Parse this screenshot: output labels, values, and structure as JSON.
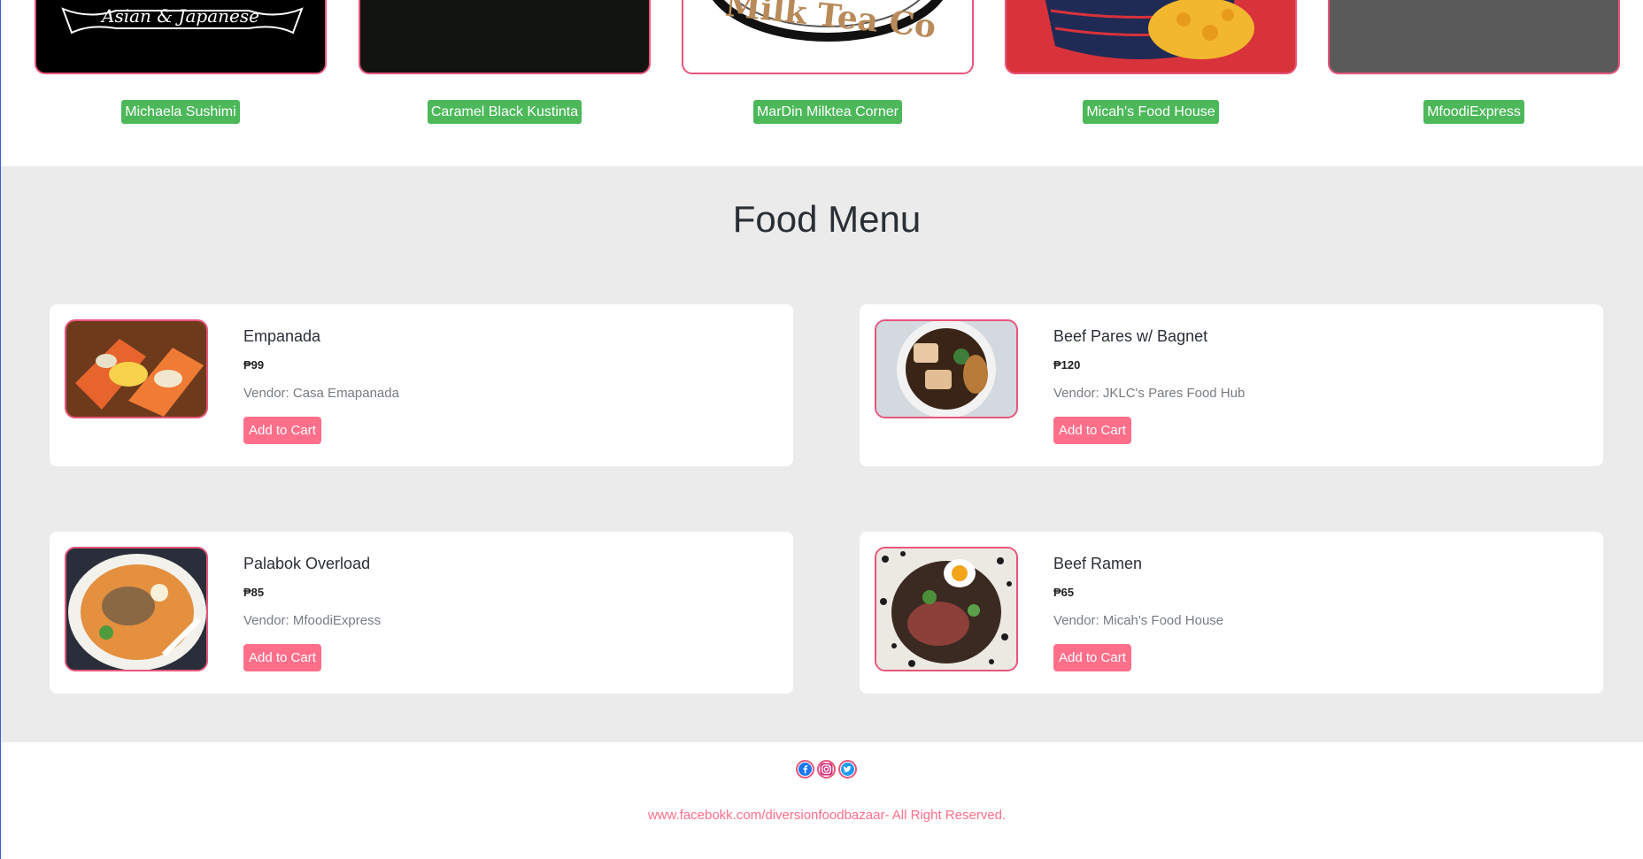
{
  "vendors": [
    {
      "name": "Michaela Sushimi",
      "logo_text": "Asian & Japanese"
    },
    {
      "name": "Caramel Black Kustinta",
      "logo_text": ""
    },
    {
      "name": "MarDin Milktea Corner",
      "logo_text": "Milk Tea Co"
    },
    {
      "name": "Micah's Food House",
      "logo_text": ""
    },
    {
      "name": "MfoodiExpress",
      "logo_text": ""
    }
  ],
  "menu": {
    "title": "Food Menu",
    "items": [
      {
        "title": "Empanada",
        "price": "₱99",
        "vendor": "Vendor: Casa Emapanada",
        "button": "Add to Cart",
        "image": "empanada-photo"
      },
      {
        "title": "Beef Pares w/ Bagnet",
        "price": "₱120",
        "vendor": "Vendor: JKLC's Pares Food Hub",
        "button": "Add to Cart",
        "image": "beef-pares-photo"
      },
      {
        "title": "Palabok Overload",
        "price": "₱85",
        "vendor": "Vendor: MfoodiExpress",
        "button": "Add to Cart",
        "image": "palabok-photo"
      },
      {
        "title": "Beef Ramen",
        "price": "₱65",
        "vendor": "Vendor: Micah's Food House",
        "button": "Add to Cart",
        "image": "beef-ramen-photo"
      }
    ]
  },
  "footer": {
    "social_icons": [
      "facebook-icon",
      "instagram-icon",
      "twitter-icon"
    ],
    "copyright": "www.facebokk.com/diversionfoodbazaar- All Right Reserved."
  },
  "colors": {
    "accent": "#ff6f8a",
    "border": "#e8557a",
    "vendor_badge": "#4cb85a",
    "menu_bg": "#ebebeb"
  }
}
